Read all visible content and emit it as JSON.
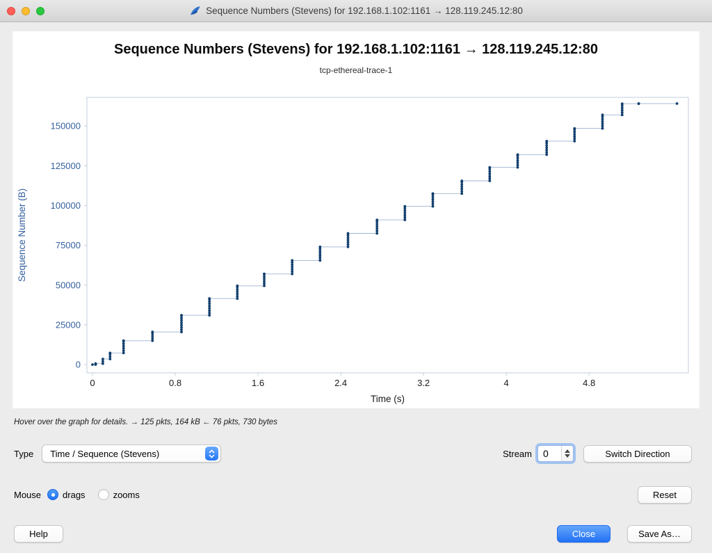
{
  "window": {
    "title": "Sequence Numbers (Stevens) for 192.168.1.102:1161 → 128.119.245.12:80"
  },
  "chart_data": {
    "type": "scatter",
    "title": "Sequence Numbers (Stevens) for 192.168.1.102:1161 → 128.119.245.12:80",
    "subtitle": "tcp-ethereal-trace-1",
    "xlabel": "Time (s)",
    "ylabel": "Sequence Number (B)",
    "xlim": [
      -0.054,
      5.76
    ],
    "ylim": [
      -5200,
      168000
    ],
    "x_ticks": [
      0,
      0.8,
      1.6,
      2.4,
      3.2,
      4,
      4.8
    ],
    "y_ticks": [
      0,
      25000,
      50000,
      75000,
      100000,
      125000,
      150000
    ],
    "grid": false,
    "legend": false,
    "segment_bytes": 1460,
    "colors": {
      "point": "#123f6e",
      "line": "#9db3cf",
      "frame": "#c3cedd",
      "x_text": "#1a1a1a",
      "y_text": "#35609f"
    },
    "bursts": [
      {
        "t": 0.0,
        "from": 0,
        "to": 0
      },
      {
        "t": 0.03,
        "from": 0,
        "to": 600
      },
      {
        "t": 0.1,
        "from": 600,
        "to": 3500
      },
      {
        "t": 0.17,
        "from": 3500,
        "to": 7300
      },
      {
        "t": 0.3,
        "from": 7300,
        "to": 15000
      },
      {
        "t": 0.58,
        "from": 15000,
        "to": 20500
      },
      {
        "t": 0.86,
        "from": 20500,
        "to": 31000
      },
      {
        "t": 1.13,
        "from": 31000,
        "to": 41500
      },
      {
        "t": 1.4,
        "from": 41500,
        "to": 49500
      },
      {
        "t": 1.66,
        "from": 49500,
        "to": 57000
      },
      {
        "t": 1.93,
        "from": 57000,
        "to": 65500
      },
      {
        "t": 2.2,
        "from": 65500,
        "to": 74000
      },
      {
        "t": 2.47,
        "from": 74000,
        "to": 82500
      },
      {
        "t": 2.75,
        "from": 82500,
        "to": 91000
      },
      {
        "t": 3.02,
        "from": 91000,
        "to": 99500
      },
      {
        "t": 3.29,
        "from": 99500,
        "to": 107500
      },
      {
        "t": 3.57,
        "from": 107500,
        "to": 115500
      },
      {
        "t": 3.84,
        "from": 115500,
        "to": 124000
      },
      {
        "t": 4.11,
        "from": 124000,
        "to": 132000
      },
      {
        "t": 4.39,
        "from": 132000,
        "to": 140500
      },
      {
        "t": 4.66,
        "from": 140500,
        "to": 148500
      },
      {
        "t": 4.93,
        "from": 148500,
        "to": 157000
      },
      {
        "t": 5.12,
        "from": 157000,
        "to": 164000
      },
      {
        "t": 5.28,
        "from": 164000,
        "to": 164090
      },
      {
        "t": 5.65,
        "from": 164090,
        "to": 164090
      }
    ]
  },
  "status": {
    "hint": "Hover over the graph for details. → 125 pkts, 164 kB ← 76 pkts, 730 bytes"
  },
  "controls": {
    "type_label": "Type",
    "type_value": "Time / Sequence (Stevens)",
    "stream_label": "Stream",
    "stream_value": "0",
    "switch_direction": "Switch Direction",
    "mouse_label": "Mouse",
    "drags_label": "drags",
    "zooms_label": "zooms",
    "reset": "Reset",
    "help": "Help",
    "close": "Close",
    "save_as": "Save As…"
  }
}
